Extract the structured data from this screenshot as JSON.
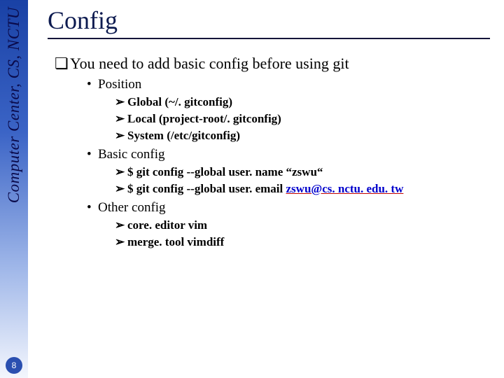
{
  "side_text": "Computer Center, CS, NCTU",
  "page_number": "8",
  "title": "Config",
  "body": {
    "l1_1": "You need to add basic config before using git",
    "l2_1": "Position",
    "l3_1": "Global (~/. gitconfig)",
    "l3_2": "Local (project-root/. gitconfig)",
    "l3_3": "System (/etc/gitconfig)",
    "l2_2": "Basic config",
    "l3_4a": "$ git config --global user. name “zswu“",
    "l3_5a": "$ git config --global user. email ",
    "l3_5b": "zswu@cs. nctu. edu. tw",
    "l2_3": "Other config",
    "l3_6": "core. editor vim",
    "l3_7": "merge. tool vimdiff"
  },
  "markers": {
    "sq": "❏",
    "dot": "•",
    "arrow": "➢"
  }
}
